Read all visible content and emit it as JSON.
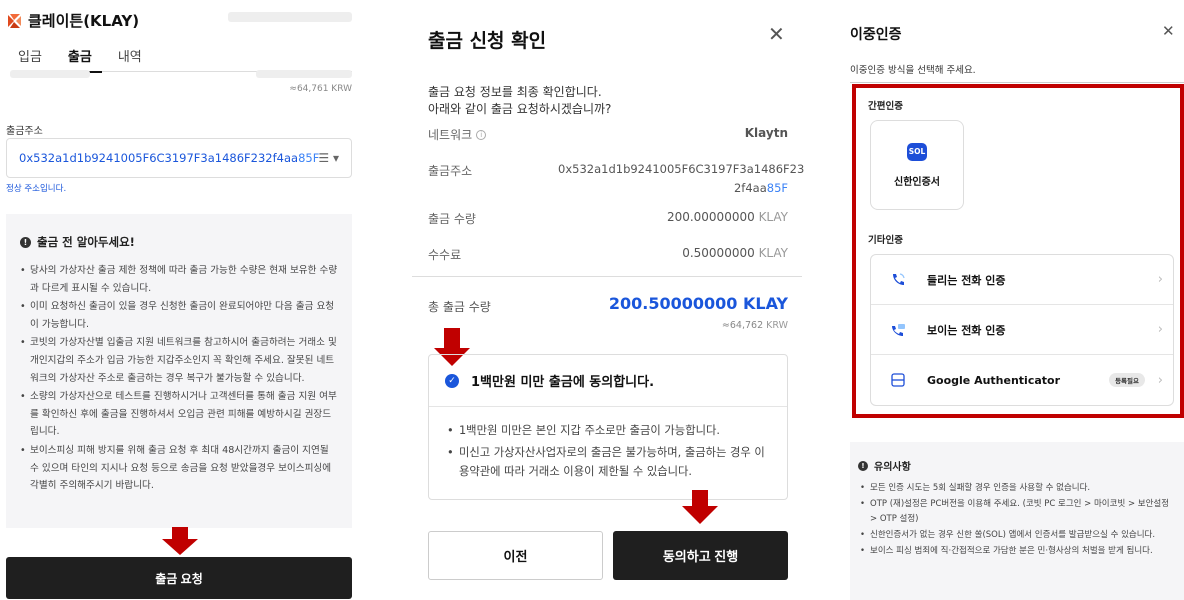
{
  "panel1": {
    "title": "클레이튼(KLAY)",
    "tabs": [
      "입금",
      "출금",
      "내역"
    ],
    "krw_approx": "≈64,761 KRW",
    "address_label": "출금주소",
    "address_prefix": "0x5",
    "address_middle": "32a1d1b9241005F6C3197F3a1486F232f4aa",
    "address_suffix": "85F",
    "address_valid": "정상 주소입니다.",
    "notice_title": "출금 전 알아두세요!",
    "notices": [
      "당사의 가상자산 출금 제한 정책에 따라 출금 가능한 수량은 현재 보유한 수량과 다르게 표시될 수 있습니다.",
      "이미 요청하신 출금이 있을 경우 신청한 출금이 완료되어야만 다음 출금 요청이 가능합니다.",
      "코빗의 가상자산별 입출금 지원 네트워크를 참고하시어 출금하려는 거래소 및 개인지갑의 주소가 입금 가능한 지갑주소인지 꼭 확인해 주세요. 잘못된 네트워크의 가상자산 주소로 출금하는 경우 복구가 불가능할 수 있습니다.",
      "소량의 가상자산으로 테스트를 진행하시거나 고객센터를 통해 출금 지원 여부를 확인하신 후에 출금을 진행하셔서 오입금 관련 피해를 예방하시길 권장드립니다.",
      "보이스피싱 피해 방지를 위해 출금 요청 후 최대 48시간까지 출금이 지연될 수 있으며 타인의 지시나 요청 등으로 송금을 요청 받았을경우 보이스피싱에 각별히 주의해주시기 바랍니다."
    ],
    "withdraw_button": "출금 요청"
  },
  "panel2": {
    "title": "출금 신청 확인",
    "desc_line1": "출금 요청 정보를 최종 확인합니다.",
    "desc_line2": "아래와 같이 출금 요청하시겠습니까?",
    "network_label": "네트워크",
    "network_value": "Klaytn",
    "address_label": "출금주소",
    "address_prefix": "0x5",
    "address_line1_rest": "32a1d1b9241005F6C3197F3a1486F23",
    "address_line2": "2f4aa",
    "address_suffix": "85F",
    "amount_label": "출금 수량",
    "amount_value": "200.00000000",
    "fee_label": "수수료",
    "fee_value": "0.50000000",
    "unit": "KLAY",
    "total_label": "총 출금 수량",
    "total_value": "200.50000000 KLAY",
    "total_krw_value": "≈64,762",
    "total_krw_unit": "KRW",
    "agree_title": "1백만원 미만 출금에 동의합니다.",
    "agree_items": [
      "1백만원 미만은 본인 지갑 주소로만 출금이 가능합니다.",
      "미신고 가상자산사업자로의 출금은 불가능하며, 출금하는 경우 이용약관에 따라 거래소 이용이 제한될 수 있습니다."
    ],
    "prev_button": "이전",
    "next_button": "동의하고 진행"
  },
  "panel3": {
    "title": "이중인증",
    "subtitle": "이중인증 방식을 선택해 주세요.",
    "simple_label": "간편인증",
    "sol_logo": "SOL",
    "sol_name": "신한인증서",
    "other_label": "기타인증",
    "auth_items": [
      {
        "label": "들리는 전화 인증",
        "icon": "phone-call-icon"
      },
      {
        "label": "보이는 전화 인증",
        "icon": "phone-screen-icon"
      },
      {
        "label": "Google Authenticator",
        "icon": "authenticator-icon",
        "badge": "등록필요"
      }
    ],
    "notice_title": "유의사항",
    "notices": [
      "모든 인증 시도는 5회 실패할 경우 인증을 사용할 수 없습니다.",
      "OTP (재)설정은 PC버전을 이용해 주세요. (코빗 PC 로그인 > 마이코빗 > 보안설정 > OTP 설정)",
      "신한인증서가 없는 경우 신한 쏠(SOL) 앱에서 인증서를 발급받으실 수 있습니다.",
      "보이스 피싱 범죄에 직·간접적으로 가담한 분은 민·형사상의 처벌을 받게 됩니다."
    ]
  },
  "colors": {
    "accent_blue": "#1a56db",
    "highlight_red": "#c00000",
    "dark_button": "#1f1f1f"
  }
}
